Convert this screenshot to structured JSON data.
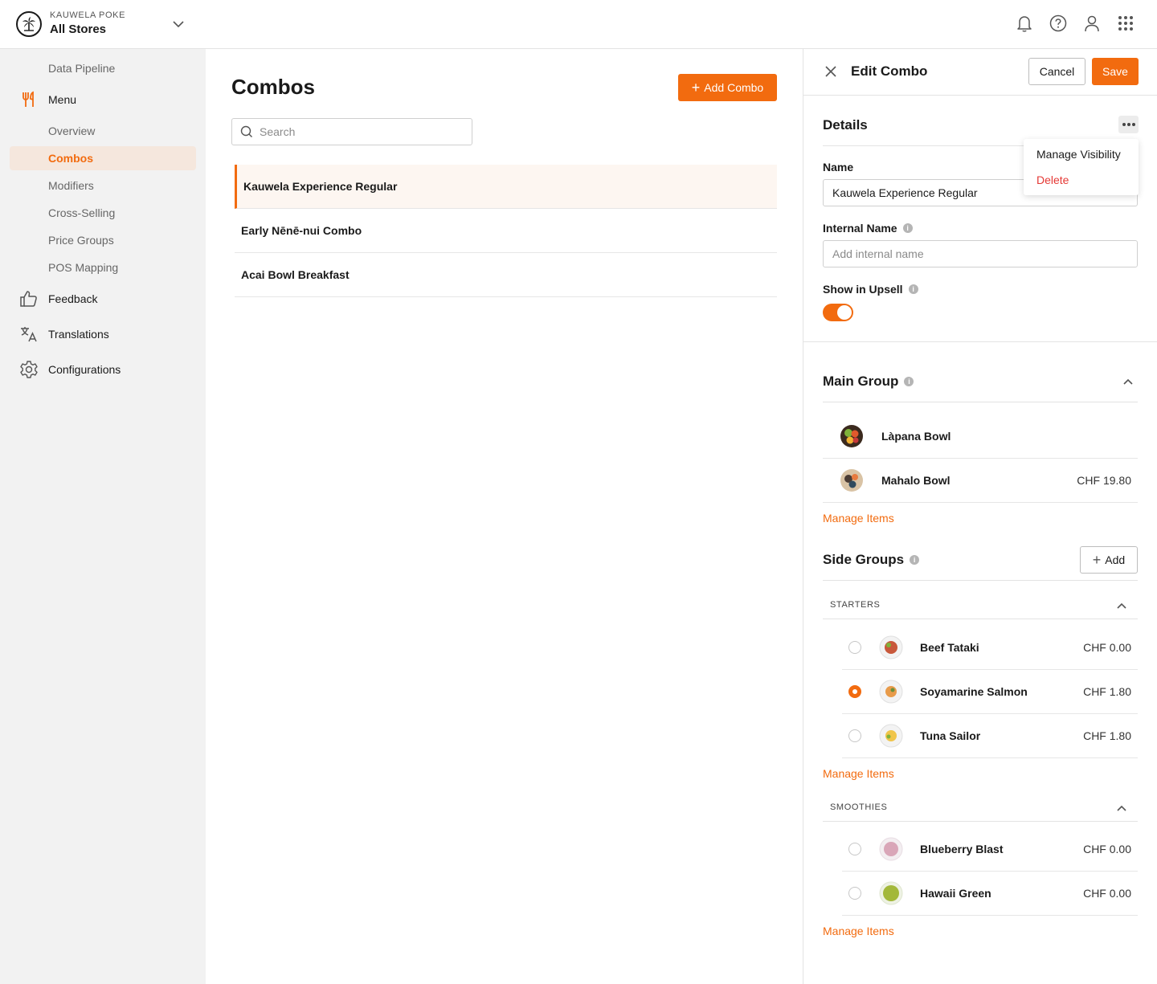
{
  "brand": {
    "name": "KAUWELA POKE",
    "store": "All Stores"
  },
  "topbar": {
    "icons": [
      "bell-icon",
      "help-icon",
      "user-icon",
      "apps-grid-icon"
    ]
  },
  "sidebar": {
    "pipeline": "Data Pipeline",
    "menu": "Menu",
    "menu_items": [
      "Overview",
      "Combos",
      "Modifiers",
      "Cross-Selling",
      "Price Groups",
      "POS Mapping"
    ],
    "active": "Combos",
    "feedback": "Feedback",
    "translations": "Translations",
    "configurations": "Configurations"
  },
  "center": {
    "title": "Combos",
    "add_button": "Add Combo",
    "search_placeholder": "Search",
    "combos": [
      "Kauwela Experience Regular",
      "Early Nēnē-nui Combo",
      "Acai Bowl Breakfast"
    ],
    "selected_index": 0
  },
  "panel": {
    "title": "Edit Combo",
    "cancel": "Cancel",
    "save": "Save",
    "details": {
      "title": "Details",
      "menu": {
        "manage_visibility": "Manage Visibility",
        "delete": "Delete"
      },
      "name_label": "Name",
      "name_value": "Kauwela Experience Regular",
      "internal_label": "Internal Name",
      "internal_placeholder": "Add internal name",
      "upsell_label": "Show in Upsell",
      "upsell_on": true
    },
    "main_group": {
      "title": "Main Group",
      "items": [
        {
          "name": "Làpana Bowl",
          "price": ""
        },
        {
          "name": "Mahalo Bowl",
          "price": "CHF 19.80"
        }
      ],
      "manage": "Manage Items"
    },
    "side_groups": {
      "title": "Side Groups",
      "add": "Add",
      "groups": [
        {
          "title": "STARTERS",
          "items": [
            {
              "name": "Beef Tataki",
              "price": "CHF 0.00",
              "selected": false
            },
            {
              "name": "Soyamarine Salmon",
              "price": "CHF 1.80",
              "selected": true
            },
            {
              "name": "Tuna Sailor",
              "price": "CHF 1.80",
              "selected": false
            }
          ],
          "manage": "Manage Items"
        },
        {
          "title": "SMOOTHIES",
          "items": [
            {
              "name": "Blueberry Blast",
              "price": "CHF 0.00",
              "selected": false
            },
            {
              "name": "Hawaii Green",
              "price": "CHF 0.00",
              "selected": false
            }
          ],
          "manage": "Manage Items"
        }
      ]
    }
  },
  "colors": {
    "accent": "#f26b0f",
    "danger": "#e53935",
    "sidebar_bg": "#f2f2f2",
    "active_bg": "#f5e7dd"
  }
}
